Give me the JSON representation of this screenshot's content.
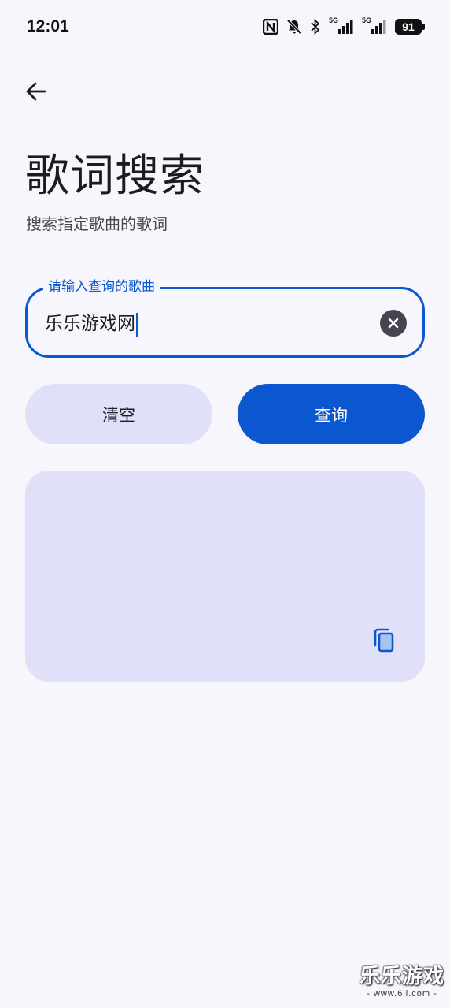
{
  "status_bar": {
    "time": "12:01",
    "signal_1_label": "5G",
    "signal_2_label": "5G",
    "battery": "91",
    "icons": [
      "nfc-icon",
      "bell-off-icon",
      "bluetooth-icon",
      "signal-icon",
      "signal-icon",
      "battery-icon"
    ]
  },
  "header": {
    "back_icon": "arrow-left-icon",
    "title": "歌词搜索",
    "subtitle": "搜索指定歌曲的歌词"
  },
  "search": {
    "label": "请输入查询的歌曲",
    "value": "乐乐游戏网",
    "clear_icon": "close-circle-icon"
  },
  "actions": {
    "clear_label": "清空",
    "query_label": "查询"
  },
  "result": {
    "text": "",
    "copy_icon": "copy-icon"
  },
  "watermark": {
    "text": "乐乐游戏",
    "url": "- www.6ll.com -"
  },
  "colors": {
    "background": "#f7f6fd",
    "primary": "#0b57d0",
    "secondary_container": "#e1e0f9",
    "on_surface": "#1c1b22"
  }
}
